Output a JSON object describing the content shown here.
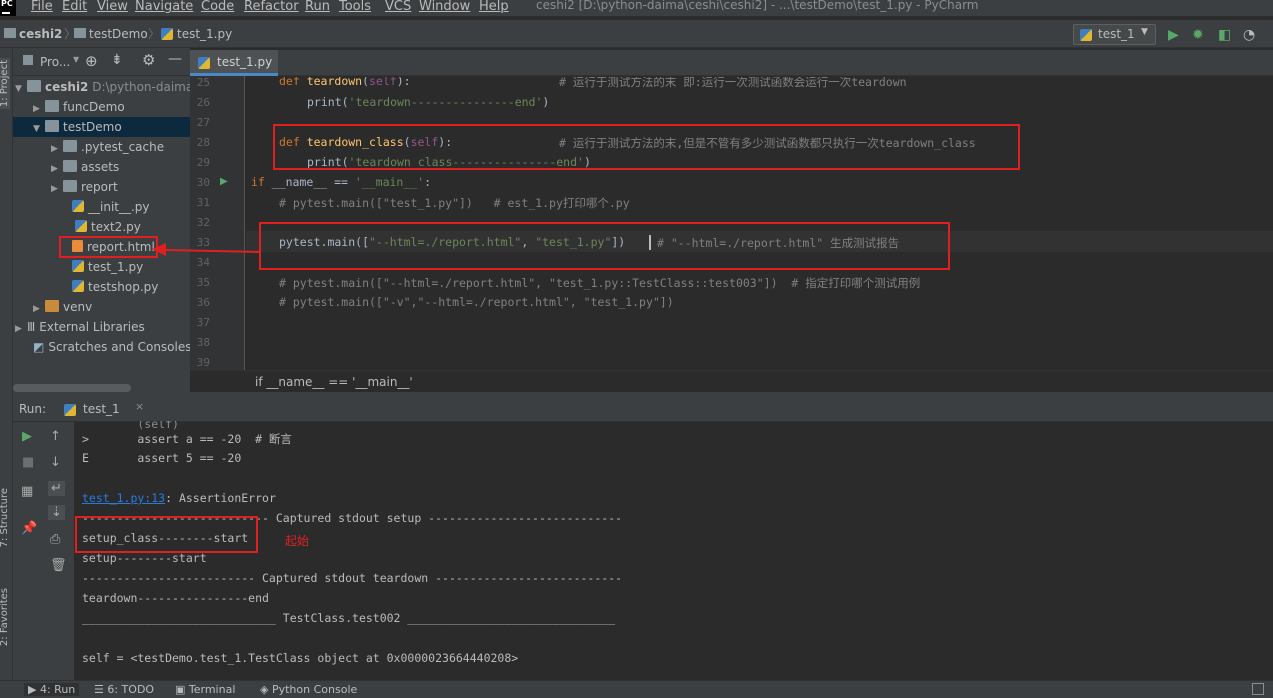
{
  "menubar": {
    "logo": "PC",
    "items": [
      "File",
      "Edit",
      "View",
      "Navigate",
      "Code",
      "Refactor",
      "Run",
      "Tools",
      "VCS",
      "Window",
      "Help"
    ],
    "title": "ceshi2 [D:\\python-daima\\ceshi\\ceshi2] - ...\\testDemo\\test_1.py - PyCharm"
  },
  "breadcrumb": [
    "ceshi2",
    "testDemo",
    "test_1.py"
  ],
  "run_config": "test_1",
  "project_panel": {
    "title": "Pro...",
    "tree": [
      {
        "label": "ceshi2",
        "suffix": "D:\\python-daima",
        "type": "folder"
      },
      {
        "label": "funcDemo",
        "type": "folder"
      },
      {
        "label": "testDemo",
        "type": "folder"
      },
      {
        "label": ".pytest_cache",
        "type": "folder"
      },
      {
        "label": "assets",
        "type": "folder"
      },
      {
        "label": "report",
        "type": "folder"
      },
      {
        "label": "__init__.py",
        "type": "py"
      },
      {
        "label": "text2.py",
        "type": "py"
      },
      {
        "label": "report.html",
        "type": "html"
      },
      {
        "label": "test_1.py",
        "type": "py"
      },
      {
        "label": "testshop.py",
        "type": "py"
      },
      {
        "label": "venv",
        "type": "folder"
      },
      {
        "label": "External Libraries",
        "type": "lib"
      },
      {
        "label": "Scratches and Consoles",
        "type": "scratch"
      }
    ]
  },
  "editor": {
    "tab": "test_1.py",
    "line_numbers": [
      "25",
      "26",
      "27",
      "28",
      "29",
      "30",
      "31",
      "32",
      "33",
      "34",
      "35",
      "36",
      "37",
      "38",
      "39"
    ],
    "lines": {
      "l25_kw": "def ",
      "l25_fn": "teardown",
      "l25_p1": "(",
      "l25_self": "self",
      "l25_p2": "):",
      "l25_cmt": "# 运行于测试方法的末 即:运行一次测试函数会运行一次teardown",
      "l26_print": "print(",
      "l26_str": "'teardown---------------end'",
      "l26_end": ")",
      "l28_kw": "def ",
      "l28_fn": "teardown_class",
      "l28_p1": "(",
      "l28_self": "self",
      "l28_p2": "):",
      "l28_cmt": "# 运行于测试方法的末,但是不管有多少测试函数都只执行一次teardown_class",
      "l29_print": "print(",
      "l29_str": "'teardown_class---------------end'",
      "l29_end": ")",
      "l30_kw": "if ",
      "l30_a": "__name__ == ",
      "l30_str": "'__main__'",
      "l30_b": ":",
      "l31_cmt": "# pytest.main([\"test_1.py\"])   # est_1.py打印哪个.py",
      "l33_a": "pytest.main([",
      "l33_s1": "\"--html=./report.html\"",
      "l33_c": ", ",
      "l33_s2": "\"test_1.py\"",
      "l33_b": "])",
      "l33_cmt": "# \"--html=./report.html\" 生成测试报告",
      "l35_cmt": "# pytest.main([\"--html=./report.html\", \"test_1.py::TestClass::test003\"])  # 指定打印哪个测试用例",
      "l36_cmt": "# pytest.main([\"-v\",\"--html=./report.html\", \"test_1.py\"])"
    },
    "breadcrumb_footer": "if __name__ == '__main__'"
  },
  "run_panel": {
    "label": "Run:",
    "tab": "test_1",
    "console": {
      "line1": ">       assert a == -20  # 断言",
      "line2": "E       assert 5 == -20",
      "link": "test_1.py:13",
      "err": ": AssertionError",
      "cap1": "--------------------------- Captured stdout setup ----------------------------",
      "setup_class": "setup_class--------start",
      "annotation": "起始",
      "setup": "setup--------start",
      "cap2": "------------------------- Captured stdout teardown ---------------------------",
      "teardown": "teardown----------------end",
      "test002": "____________________________ TestClass.test002 ______________________________",
      "self_line": "self = <testDemo.test_1.TestClass object at 0x0000023664440208>"
    }
  },
  "statusbar": {
    "run": "4: Run",
    "todo": "6: TODO",
    "terminal": "Terminal",
    "python_console": "Python Console"
  },
  "side_tabs": {
    "project": "1: Project",
    "structure": "7: Structure",
    "favorites": "2: Favorites"
  },
  "colors": {
    "annotation_red": "#e02020",
    "accent": "#4a88c7"
  }
}
